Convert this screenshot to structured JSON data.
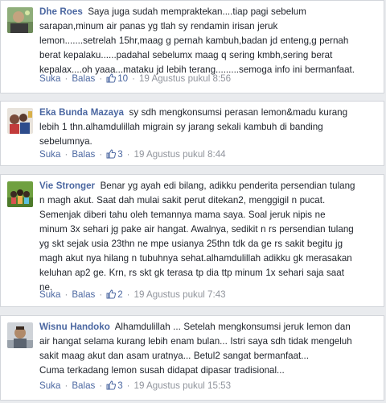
{
  "actions": {
    "like": "Suka",
    "reply": "Balas",
    "dot": "·"
  },
  "comments": [
    {
      "author": "Dhe Roes",
      "lines": [
        "Saya juga sudah mempraktekan....tiap pagi sebelum",
        "sarapan,minum air panas yg tlah sy rendamin irisan jeruk",
        "lemon.......setrelah 15hr,maag g pernah kambuh,badan jd enteng,g pernah",
        "berat kepalaku......padahal sebelumx maag q sering kmbh,sering berat",
        "kepalax....oh yaaa...mataku jd lebih terang.........semoga info ini bermanfaat."
      ],
      "likes": "10",
      "time": "19 Agustus pukul 8:56"
    },
    {
      "author": "Eka Bunda Mazaya",
      "lines": [
        "sy sdh mengkonsumsi perasan lemon&madu kurang",
        "lebih 1 thn.alhamdulillah migrain sy jarang sekali kambuh di banding",
        "sebelumnya."
      ],
      "likes": "3",
      "time": "19 Agustus pukul 8:44"
    },
    {
      "author": "Vie Stronger",
      "lines": [
        "Benar yg ayah edi bilang, adikku penderita persendian tulang",
        "n magh akut. Saat dah mulai sakit perut ditekan2, menggigil n pucat.",
        "Semenjak diberi tahu oleh temannya mama saya. Soal jeruk nipis ne",
        "minum 3x sehari jg pake air hangat. Awalnya, sedikit n rs persendian tulang",
        "yg skt sejak usia 23thn ne mpe usianya 25thn tdk da ge rs sakit begitu jg",
        "magh akut nya hilang n tubuhnya sehat.alhamdulillah adikku gk merasakan",
        "keluhan ap2 ge. Krn, rs skt gk terasa tp dia ttp minum 1x sehari saja saat",
        "ne."
      ],
      "likes": "2",
      "time": "19 Agustus pukul 7:43"
    },
    {
      "author": "Wisnu Handoko",
      "lines": [
        "Alhamdulillah ... Setelah mengkonsumsi jeruk lemon dan",
        "air hangat selama kurang lebih enam bulan... Istri saya sdh tidak mengeluh",
        "sakit maag akut dan asam uratnya... Betul2 sangat bermanfaat...",
        "Cuma terkadang lemon susah didapat dipasar tradisional..."
      ],
      "likes": "3",
      "time": "19 Agustus pukul 15:53"
    }
  ]
}
